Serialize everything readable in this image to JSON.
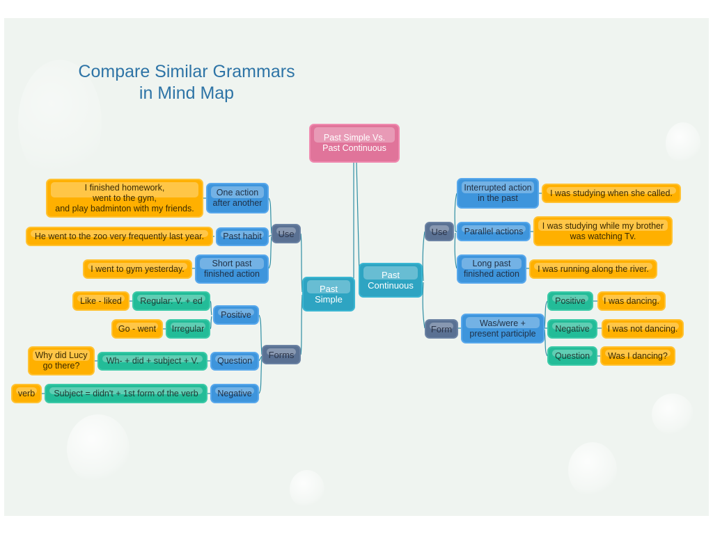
{
  "title": [
    "Compare Similar Grammars",
    "in Mind Map"
  ],
  "colors": {
    "root": "#e0749a",
    "hub": "#2ea4c2",
    "category": "#5a7193",
    "blue": "#3e95dc",
    "green": "#23bc98",
    "orange": "#ffb000",
    "title": "#2e74a6",
    "connector": "#2f8ea3"
  },
  "root": [
    "Past Simple Vs.",
    "Past Continuous"
  ],
  "past_simple": {
    "label": [
      "Past",
      "Simple"
    ],
    "use": {
      "label": "Use",
      "items": [
        {
          "label": [
            "One action",
            "after another"
          ],
          "example": [
            "I finished homework,",
            "went to the gym,",
            "and play badminton with my friends."
          ]
        },
        {
          "label": [
            "Past habit"
          ],
          "example": [
            "He went to the zoo very frequently last year."
          ]
        },
        {
          "label": [
            "Short past",
            "finished action"
          ],
          "example": [
            "I went to gym yesterday."
          ]
        }
      ]
    },
    "forms": {
      "label": "Forms",
      "positive": {
        "label": "Positive",
        "rules": [
          {
            "rule": "Regular: V. + ed",
            "example": "Like - liked"
          },
          {
            "rule": "Irregular",
            "example": "Go - went"
          }
        ]
      },
      "question": {
        "label": "Question",
        "rule": "Wh- + did + subject + V.",
        "example": [
          "Why did Lucy",
          "go there?"
        ]
      },
      "negative": {
        "label": "Negative",
        "rule": "Subject = didn't + 1st form of the verb",
        "example": "verb"
      }
    }
  },
  "past_continuous": {
    "label": [
      "Past",
      "Continuous"
    ],
    "use": {
      "label": "Use",
      "items": [
        {
          "label": [
            "Interrupted action",
            "in the past"
          ],
          "example": [
            "I was studying when she called."
          ]
        },
        {
          "label": [
            "Parallel actions"
          ],
          "example": [
            "I was studying while my brother",
            "was watching Tv."
          ]
        },
        {
          "label": [
            "Long past",
            "finished action"
          ],
          "example": [
            "I was running along the river."
          ]
        }
      ]
    },
    "form": {
      "label": "Form",
      "rule": [
        "Was/were +",
        "present participle"
      ],
      "types": [
        {
          "label": "Positive",
          "example": "I was dancing."
        },
        {
          "label": "Negative",
          "example": "I was not dancing."
        },
        {
          "label": "Question",
          "example": "Was I dancing?"
        }
      ]
    }
  }
}
